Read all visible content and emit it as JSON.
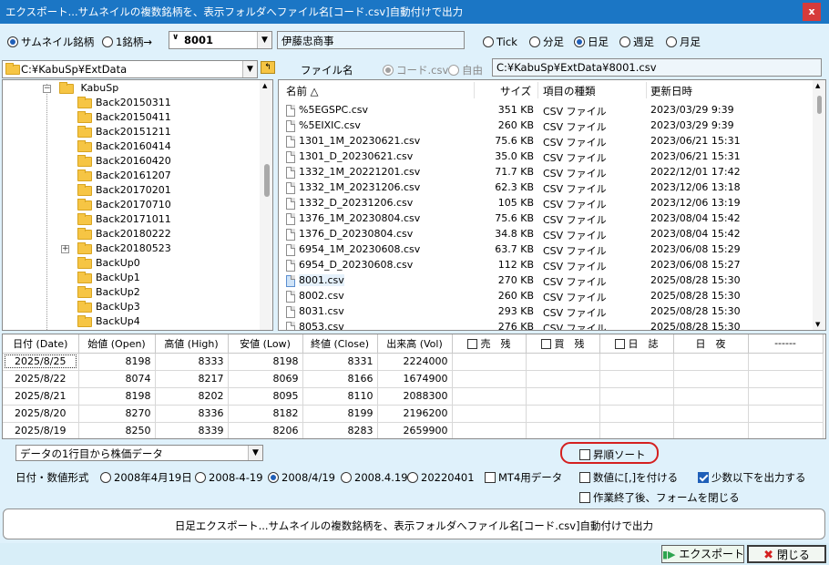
{
  "window": {
    "title": "エクスポート...サムネイルの複数銘柄を、表示フォルダへファイル名[コード.csv]自動付けで出力",
    "close_label": "x"
  },
  "source": {
    "thumbnail_label": "サムネイル銘柄",
    "single_label": "1銘柄→",
    "code_value": "8001",
    "name_value": "伊藤忠商事"
  },
  "timeframe": {
    "options": [
      "Tick",
      "分足",
      "日足",
      "週足",
      "月足"
    ],
    "selected": "日足"
  },
  "folder": {
    "path": "C:¥KabuSp¥ExtData",
    "filename_label": "ファイル名",
    "filename_code_label": "コード.csv",
    "filename_free_label": "自由",
    "output_path": "C:¥KabuSp¥ExtData¥8001.csv"
  },
  "tree": {
    "root": "KabuSp",
    "items": [
      "Back20150311",
      "Back20150411",
      "Back20151211",
      "Back20160414",
      "Back20160420",
      "Back20161207",
      "Back20170201",
      "Back20170710",
      "Back20171011",
      "Back20180222",
      "Back20180523",
      "BackUp0",
      "BackUp1",
      "BackUp2",
      "BackUp3",
      "BackUp4"
    ]
  },
  "filelist": {
    "headers": {
      "name": "名前 △",
      "size": "サイズ",
      "type": "項目の種類",
      "date": "更新日時"
    },
    "rows": [
      {
        "name": "%5EGSPC.csv",
        "size": "351 KB",
        "type": "CSV ファイル",
        "date": "2023/03/29 9:39"
      },
      {
        "name": "%5EIXIC.csv",
        "size": "260 KB",
        "type": "CSV ファイル",
        "date": "2023/03/29 9:39"
      },
      {
        "name": "1301_1M_20230621.csv",
        "size": "75.6 KB",
        "type": "CSV ファイル",
        "date": "2023/06/21 15:31"
      },
      {
        "name": "1301_D_20230621.csv",
        "size": "35.0 KB",
        "type": "CSV ファイル",
        "date": "2023/06/21 15:31"
      },
      {
        "name": "1332_1M_20221201.csv",
        "size": "71.7 KB",
        "type": "CSV ファイル",
        "date": "2022/12/01 17:42"
      },
      {
        "name": "1332_1M_20231206.csv",
        "size": "62.3 KB",
        "type": "CSV ファイル",
        "date": "2023/12/06 13:18"
      },
      {
        "name": "1332_D_20231206.csv",
        "size": "105 KB",
        "type": "CSV ファイル",
        "date": "2023/12/06 13:19"
      },
      {
        "name": "1376_1M_20230804.csv",
        "size": "75.6 KB",
        "type": "CSV ファイル",
        "date": "2023/08/04 15:42"
      },
      {
        "name": "1376_D_20230804.csv",
        "size": "34.8 KB",
        "type": "CSV ファイル",
        "date": "2023/08/04 15:42"
      },
      {
        "name": "6954_1M_20230608.csv",
        "size": "63.7 KB",
        "type": "CSV ファイル",
        "date": "2023/06/08 15:29"
      },
      {
        "name": "6954_D_20230608.csv",
        "size": "112 KB",
        "type": "CSV ファイル",
        "date": "2023/06/08 15:27"
      },
      {
        "name": "8001.csv",
        "size": "270 KB",
        "type": "CSV ファイル",
        "date": "2025/08/28 15:30"
      },
      {
        "name": "8002.csv",
        "size": "260 KB",
        "type": "CSV ファイル",
        "date": "2025/08/28 15:30"
      },
      {
        "name": "8031.csv",
        "size": "293 KB",
        "type": "CSV ファイル",
        "date": "2025/08/28 15:30"
      },
      {
        "name": "8053.csv",
        "size": "276 KB",
        "type": "CSV ファイル",
        "date": "2025/08/28 15:30"
      }
    ],
    "selected_index": 11
  },
  "grid": {
    "headers": [
      "日付 (Date)",
      "始値 (Open)",
      "高値 (High)",
      "安値 (Low)",
      "終値 (Close)",
      "出来高 (Vol)",
      "売　残",
      "買　残",
      "日　誌",
      "日　夜",
      "------"
    ],
    "rows": [
      [
        "2025/8/25",
        "8198",
        "8333",
        "8198",
        "8331",
        "2224000"
      ],
      [
        "2025/8/22",
        "8074",
        "8217",
        "8069",
        "8166",
        "1674900"
      ],
      [
        "2025/8/21",
        "8198",
        "8202",
        "8095",
        "8110",
        "2088300"
      ],
      [
        "2025/8/20",
        "8270",
        "8336",
        "8182",
        "8199",
        "2196200"
      ],
      [
        "2025/8/19",
        "8250",
        "8339",
        "8206",
        "8283",
        "2659900"
      ]
    ]
  },
  "options": {
    "data_mode": "データの1行目から株価データ",
    "ascending_label": "昇順ソート",
    "date_format_label": "日付・数値形式",
    "date_formats": [
      "2008年4月19日",
      "2008-4-19",
      "2008/4/19",
      "2008.4.19",
      "20220401"
    ],
    "date_format_selected": "2008/4/19",
    "mt4_label": "MT4用データ",
    "quote_label": "数値に[,]を付ける",
    "decimal_label": "少数以下を出力する",
    "close_after_label": "作業終了後、フォームを閉じる"
  },
  "status": {
    "message": "日足エクスポート...サムネイルの複数銘柄を、表示フォルダへファイル名[コード.csv]自動付けで出力"
  },
  "buttons": {
    "export_label": "エクスポート",
    "close_label": "閉じる"
  },
  "colors": {
    "titlebar": "#1b76c5",
    "background": "#dff1fb",
    "highlight_ring": "#d42020",
    "accent": "#1f5fb8"
  }
}
